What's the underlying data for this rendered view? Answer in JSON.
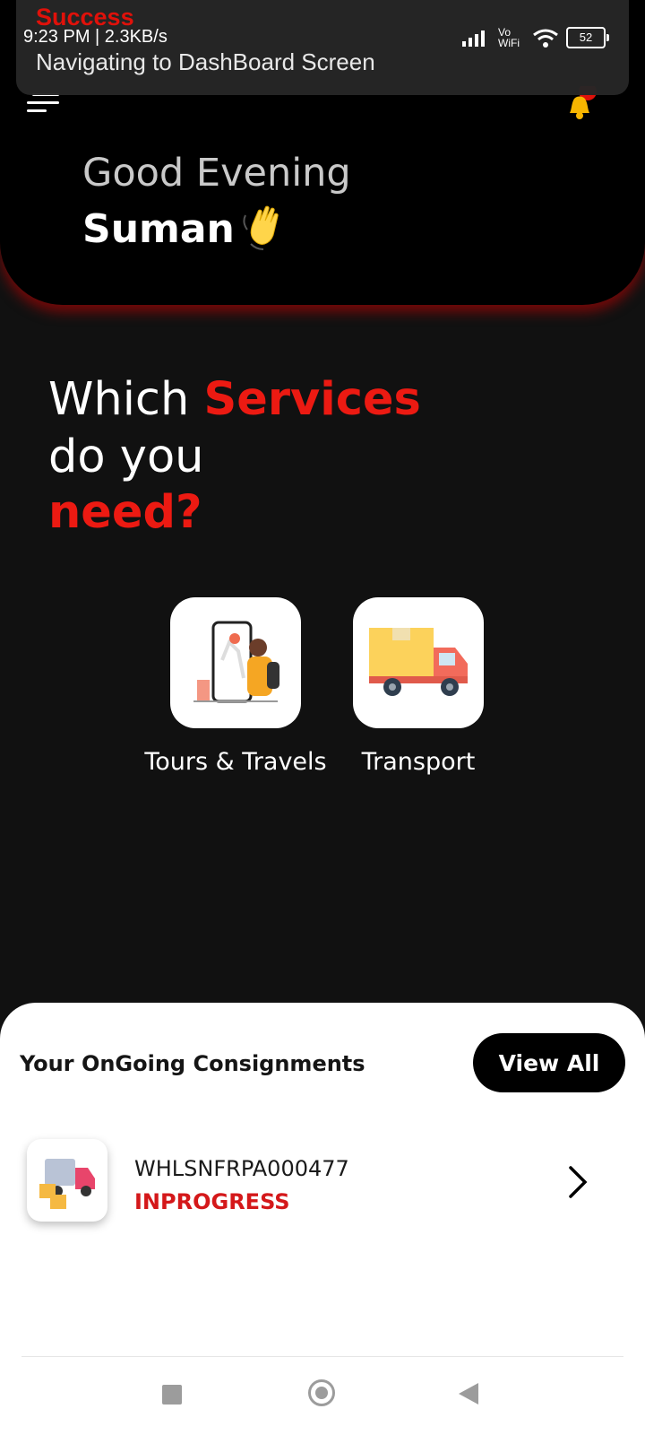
{
  "toast": {
    "title": "Success",
    "message": "Navigating to DashBoard Screen"
  },
  "status_bar": {
    "time": "9:23 PM | 2.3KB/s",
    "vowifi": "Vo WiFi",
    "battery": "52"
  },
  "header": {
    "greeting": "Good Evening",
    "user_name": "Suman"
  },
  "services": {
    "heading_part1": "Which ",
    "heading_highlight": "Services",
    "heading_part2": "do you",
    "heading_part3": "need?",
    "items": [
      {
        "label": "Tours & Travels"
      },
      {
        "label": "Transport"
      }
    ]
  },
  "consignments": {
    "title": "Your OnGoing Consignments",
    "view_all_label": "View All",
    "items": [
      {
        "id": "WHLSNFRPA000477",
        "status": "INPROGRESS"
      }
    ]
  },
  "colors": {
    "accent": "#ec1a12",
    "background": "#111111",
    "sheet": "#ffffff"
  }
}
